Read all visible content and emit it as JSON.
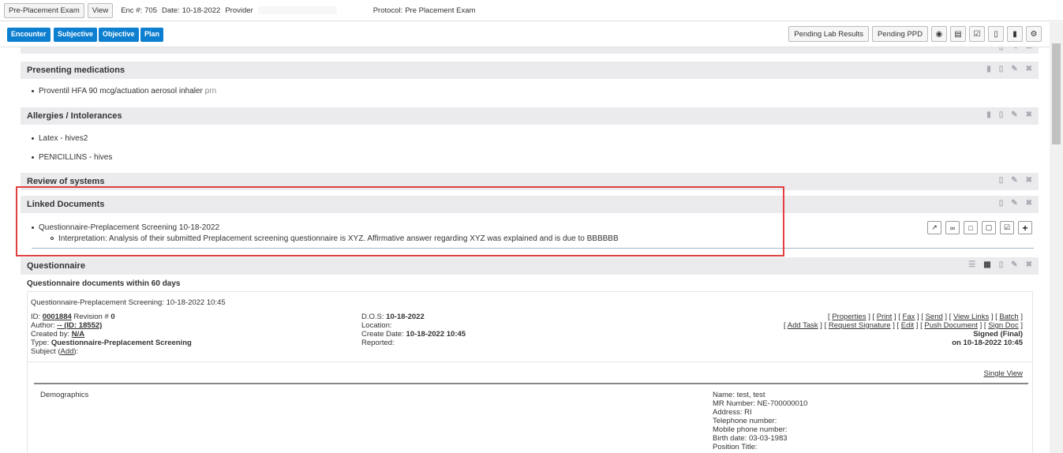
{
  "topbar": {
    "exam_button": "Pre-Placement Exam",
    "view_button": "View",
    "enc_label": "Enc #:",
    "enc_value": "705",
    "date_label": "Date:",
    "date_value": "10-18-2022",
    "provider_label": "Provider",
    "protocol_label": "Protocol:",
    "protocol_value": "Pre Placement Exam"
  },
  "nav": {
    "tabs": [
      "Encounter",
      "Subjective",
      "Objective",
      "Plan"
    ],
    "pending_lab": "Pending Lab Results",
    "pending_ppd": "Pending PPD"
  },
  "sections": {
    "presenting": {
      "title": "Presenting medications",
      "items": [
        "Proventil HFA 90 mcg/actuation aerosol inhaler"
      ],
      "item_suffix": "prn"
    },
    "allergies": {
      "title": "Allergies / Intolerances",
      "items": [
        "Latex - hives2",
        "PENICILLINS - hives"
      ]
    },
    "ros": {
      "title": "Review of systems"
    },
    "linked": {
      "title": "Linked Documents",
      "item": "Questionnaire-Preplacement Screening 10-18-2022",
      "interpretation": "Interpretation: Analysis of their submitted Preplacement screening questionnaire is XYZ. Affirmative answer regarding XYZ was explained and is due to BBBBBB"
    },
    "questionnaire": {
      "title": "Questionnaire",
      "subtitle": "Questionnaire documents within 60 days",
      "doc_header": "Questionnaire-Preplacement Screening: 10-18-2022 10:45",
      "id_label": "ID:",
      "id_value": "0001884",
      "revision_label": "Revision #",
      "revision_value": "0",
      "author_label": "Author:",
      "author_value": "-- (ID: 18552)",
      "created_by_label": "Created by:",
      "created_by_value": "N/A",
      "type_label": "Type:",
      "type_value": "Questionnaire-Preplacement Screening",
      "subject_label": "Subject (",
      "subject_link": "Add",
      "subject_end": "):",
      "dos_label": "D.O.S:",
      "dos_value": "10-18-2022",
      "location_label": "Location:",
      "create_date_label": "Create Date:",
      "create_date_value": "10-18-2022 10:45",
      "reported_label": "Reported:",
      "links_row1": [
        "Properties",
        "Print",
        "Fax",
        "Send",
        "View Links",
        "Batch"
      ],
      "links_row2": [
        "Add Task",
        "Request Signature",
        "Edit",
        "Push Document",
        "Sign Doc"
      ],
      "signed": "Signed (Final)",
      "signed_on": "on 10-18-2022 10:45",
      "single_view": "Single View",
      "demographics": "Demographics",
      "demo_lines": [
        "Name: test, test",
        "MR Number: NE-700000010",
        "Address: RI",
        "Telephone number:",
        "Mobile phone number:",
        "Birth date: 03-03-1983",
        "Position Title:"
      ]
    }
  }
}
